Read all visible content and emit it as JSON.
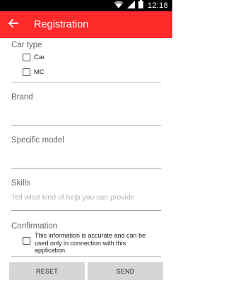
{
  "status_bar": {
    "time": "12:18"
  },
  "app_bar": {
    "title": "Registration",
    "back_icon": "arrow-left-icon"
  },
  "form": {
    "car_type": {
      "label": "Car type",
      "options": [
        {
          "label": "Car",
          "checked": false
        },
        {
          "label": "MC",
          "checked": false
        }
      ]
    },
    "brand": {
      "label": "Brand",
      "value": ""
    },
    "specific_model": {
      "label": "Specific model",
      "value": ""
    },
    "skills": {
      "label": "Skills",
      "placeholder": "Tell what kind of help you can provide",
      "value": ""
    },
    "confirmation": {
      "label": "Confirmation",
      "text": "This information is accurate and can be used only in connection with this application.",
      "checked": false
    }
  },
  "buttons": {
    "reset": "RESET",
    "send": "SEND"
  },
  "colors": {
    "accent": "#ff2a2a",
    "status_bar": "#000000",
    "button_bg": "#d6d6d6"
  }
}
